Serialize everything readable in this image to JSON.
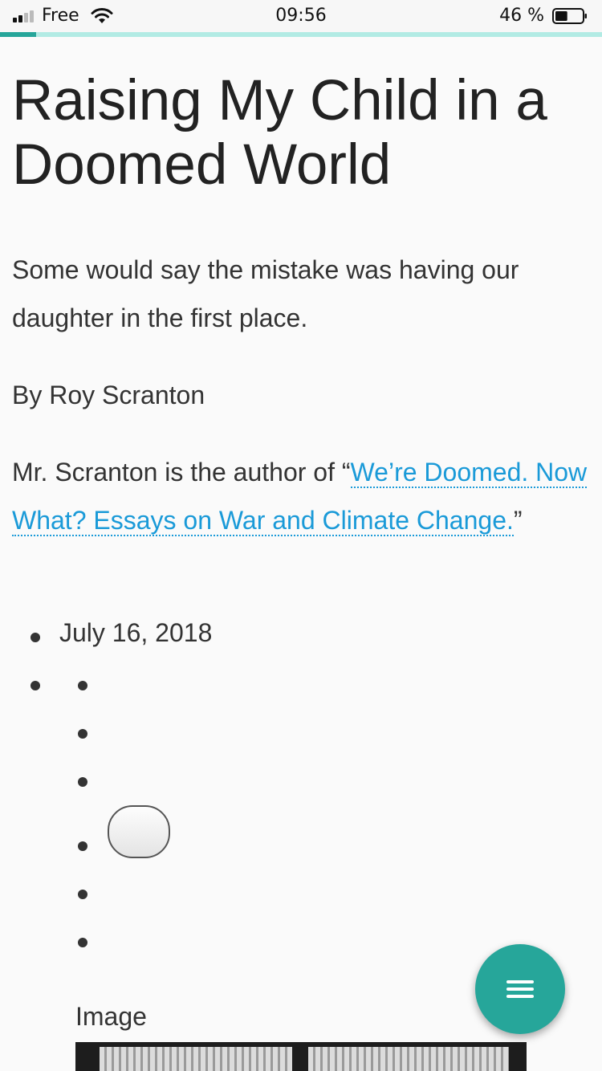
{
  "status_bar": {
    "carrier": "Free",
    "time": "09:56",
    "battery_percent": "46 %",
    "battery_level": 0.46
  },
  "reading_progress": 0.06,
  "article": {
    "headline": "Raising My Child in a Doomed World",
    "summary": "Some would say the mistake was having our daughter in the first place.",
    "byline": "By Roy Scranton",
    "bio_prefix": "Mr. Scranton is the author of “",
    "bio_link": "We’re Doomed. Now What? Essays on War and Climate Change.",
    "bio_suffix": "”",
    "date": "July 16, 2018",
    "image_label": "Image"
  },
  "icons": {
    "signal": "cellular-signal-icon",
    "wifi": "wifi-icon",
    "battery": "battery-icon",
    "menu": "hamburger-menu-icon"
  },
  "colors": {
    "accent": "#26a69a",
    "link": "#1a9ad8"
  }
}
